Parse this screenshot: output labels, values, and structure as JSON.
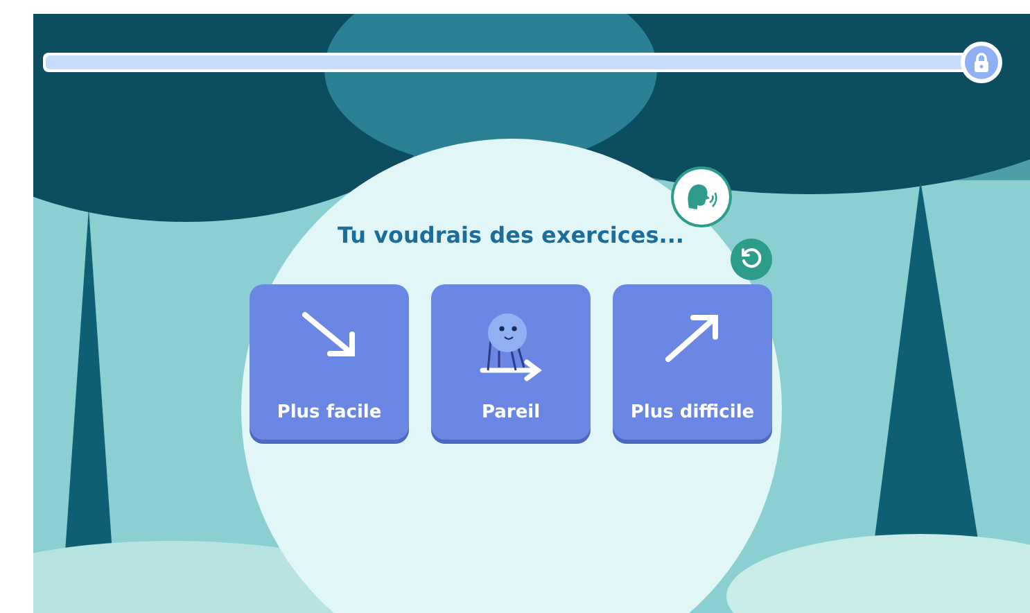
{
  "progress": {
    "level": 1
  },
  "prompt": "Tu voudrais des exercices...",
  "choices": [
    {
      "kind": "easier",
      "label": "Plus facile"
    },
    {
      "kind": "same",
      "label": "Pareil"
    },
    {
      "kind": "harder",
      "label": "Plus difficile"
    }
  ]
}
